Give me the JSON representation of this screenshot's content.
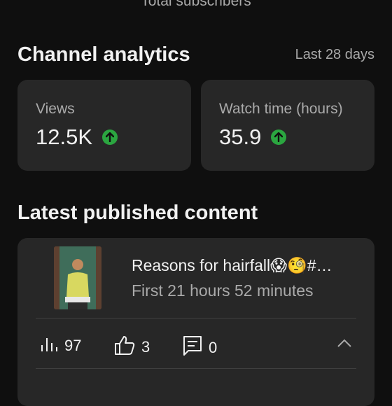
{
  "header": {
    "caption": "Total subscribers"
  },
  "analytics": {
    "title": "Channel analytics",
    "period": "Last 28 days",
    "views": {
      "label": "Views",
      "value": "12.5K",
      "trend": "up"
    },
    "watch_time": {
      "label": "Watch time (hours)",
      "value": "35.9",
      "trend": "up"
    }
  },
  "latest": {
    "title": "Latest published content",
    "video": {
      "title": "Reasons for hairfall😱🧐#…",
      "meta": "First 21 hours 52 minutes",
      "views": "97",
      "likes": "3",
      "comments": "0"
    }
  },
  "colors": {
    "background": "#0f0f0f",
    "card": "#272727",
    "trend_up": "#2ba640",
    "muted_text": "#aaaaaa"
  },
  "icons": [
    "arrow-up-icon",
    "bar-chart-icon",
    "thumbs-up-icon",
    "comment-icon",
    "chevron-up-icon"
  ]
}
